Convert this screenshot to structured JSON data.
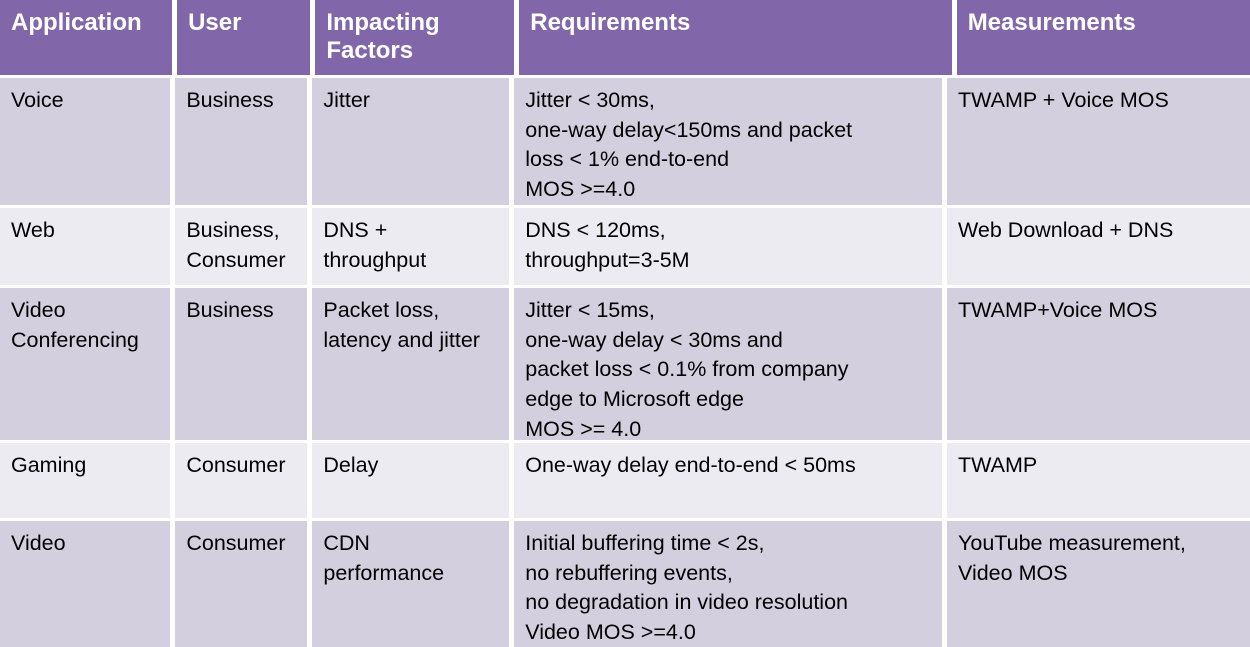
{
  "table": {
    "columns": [
      {
        "id": "application",
        "label": "Application"
      },
      {
        "id": "user",
        "label": "User"
      },
      {
        "id": "impacting_factors",
        "label": "Impacting\nFactors"
      },
      {
        "id": "requirements",
        "label": "Requirements"
      },
      {
        "id": "measurements",
        "label": "Measurements"
      }
    ],
    "colors": {
      "header_background": "#8167a9",
      "header_text": "#ffffff",
      "row_background_odd": "#d3cfdf",
      "row_background_even": "#edebf2",
      "body_text": "#000000",
      "grid_line": "#ffffff"
    },
    "rows": [
      {
        "application": "Voice",
        "user": "Business",
        "impacting_factors": "Jitter",
        "requirements": "Jitter < 30ms,\none-way delay<150ms and packet\nloss < 1% end-to-end\nMOS >=4.0",
        "measurements": "TWAMP + Voice MOS"
      },
      {
        "application": "Web",
        "user": "Business,\nConsumer",
        "impacting_factors": "DNS +\nthroughput",
        "requirements": "DNS < 120ms,\nthroughput=3-5M",
        "measurements": "Web Download + DNS"
      },
      {
        "application": "Video\nConferencing",
        "user": "Business",
        "impacting_factors": "Packet loss,\nlatency and jitter",
        "requirements": "Jitter < 15ms,\none-way delay < 30ms and\npacket loss < 0.1% from company\nedge to Microsoft edge\nMOS >= 4.0",
        "measurements": "TWAMP+Voice MOS"
      },
      {
        "application": "Gaming",
        "user": "Consumer",
        "impacting_factors": "Delay",
        "requirements": "One-way delay end-to-end < 50ms",
        "measurements": "TWAMP"
      },
      {
        "application": "Video",
        "user": "Consumer",
        "impacting_factors": "CDN\nperformance",
        "requirements": "Initial buffering time < 2s,\nno rebuffering events,\nno degradation in video resolution\nVideo MOS >=4.0",
        "measurements": "YouTube measurement,\nVideo MOS"
      }
    ]
  }
}
